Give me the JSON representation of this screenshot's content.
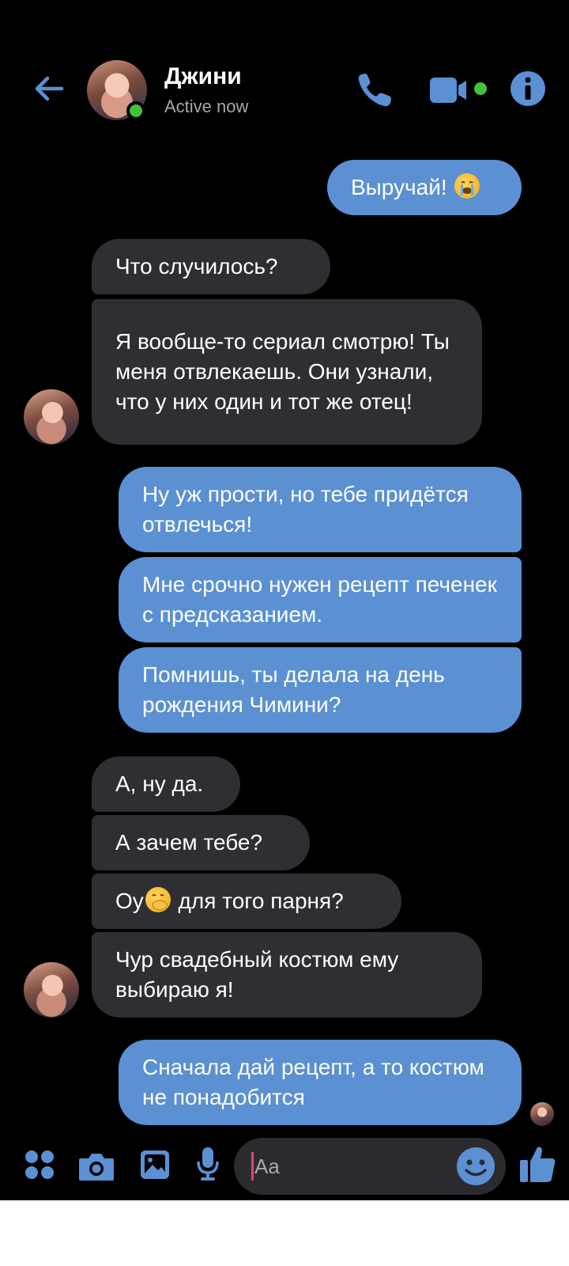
{
  "header": {
    "contact_name": "Джини",
    "status": "Active now"
  },
  "messages": [
    {
      "side": "out",
      "text": "Выручай!",
      "emoji": "crying-face"
    },
    {
      "side": "in",
      "text": "Что случилось?"
    },
    {
      "side": "in",
      "text": "Я вообще-то сериал смотрю! Ты меня отвлекаешь. Они узнали, что у них один и тот же отец!"
    },
    {
      "side": "out",
      "text": "Ну уж прости, но тебе придётся отвлечься!"
    },
    {
      "side": "out",
      "text": "Мне срочно нужен рецепт печенек с предсказанием."
    },
    {
      "side": "out",
      "text": "Помнишь, ты делала на день рождения Чимини?"
    },
    {
      "side": "in",
      "text": "А, ну да."
    },
    {
      "side": "in",
      "text": "А зачем тебе?"
    },
    {
      "side": "in",
      "text_before": "Оу",
      "emoji": "hand-over-mouth-face",
      "text_after": " для того парня?"
    },
    {
      "side": "in",
      "text": "Чур свадебный костюм ему выбираю я!"
    },
    {
      "side": "out",
      "text": "Сначала дай рецепт, а то костюм не понадобится"
    }
  ],
  "composer": {
    "placeholder": "Aa"
  },
  "colors": {
    "background": "#000000",
    "outgoing_bubble": "#5b90d3",
    "incoming_bubble": "#2f2f33",
    "accent": "#5b90d3",
    "online": "#44c23a"
  },
  "icons": [
    "back-arrow-icon",
    "phone-icon",
    "video-camera-icon",
    "info-icon",
    "apps-icon",
    "camera-icon",
    "gallery-icon",
    "microphone-icon",
    "emoji-icon",
    "thumbs-up-icon"
  ]
}
